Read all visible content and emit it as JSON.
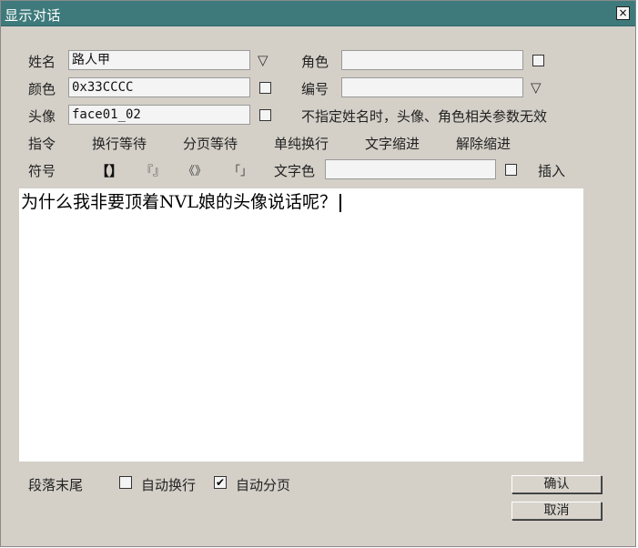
{
  "window": {
    "title": "显示对话",
    "close_glyph": "×"
  },
  "form": {
    "name_label": "姓名",
    "name_value": "路人甲",
    "role_label": "角色",
    "role_value": "",
    "color_label": "颜色",
    "color_value": "0x33CCCC",
    "number_label": "编号",
    "number_value": "",
    "avatar_label": "头像",
    "avatar_value": "face01_02",
    "avatar_hint": "不指定姓名时，头像、角色相关参数无效",
    "dropdown_glyph": "▽"
  },
  "commands": {
    "label": "指令",
    "items": [
      "换行等待",
      "分页等待",
      "单纯换行",
      "文字缩进",
      "解除缩进"
    ]
  },
  "symbols": {
    "label": "符号",
    "items": [
      "【】",
      "『』",
      "《》",
      "「」"
    ],
    "text_color_label": "文字色",
    "text_color_value": "",
    "insert_label": "插入"
  },
  "editor": {
    "content": "为什么我非要顶着NVL娘的头像说话呢？"
  },
  "footer": {
    "paragraph_end_label": "段落末尾",
    "auto_newline_label": "自动换行",
    "auto_newline_checked": false,
    "auto_page_label": "自动分页",
    "auto_page_checked": true,
    "check_glyph": "✔",
    "ok_label": "确认",
    "cancel_label": "取消"
  }
}
